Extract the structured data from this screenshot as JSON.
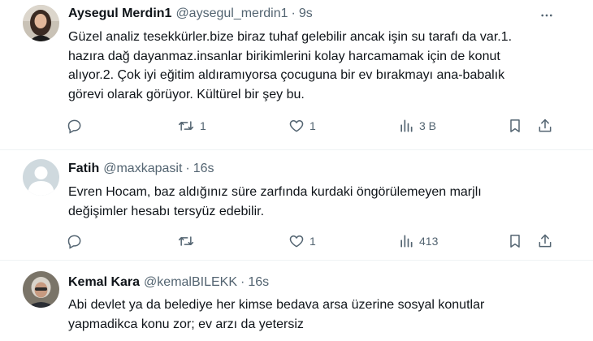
{
  "tweets": [
    {
      "name": "Aysegul Merdin1",
      "handle": "@aysegul_merdin1",
      "dot": "·",
      "time": "9s",
      "lines": [
        "Güzel analiz tesekkürler.bize biraz tuhaf gelebilir ancak işin su tarafı da var.1.",
        "hazıra dağ dayanmaz.insanlar birikimlerini kolay harcamamak için de konut",
        "alıyor.2. Çok iyi eğitim aldıramıyorsa çocuguna bir ev bırakmayı ana-babalık",
        "görevi olarak görüyor. Kültürel bir şey bu."
      ],
      "retweets": "1",
      "likes": "1",
      "views": "3 B"
    },
    {
      "name": "Fatih",
      "handle": "@maxkapasit",
      "dot": "·",
      "time": "16s",
      "lines": [
        "Evren Hocam, baz aldığınız süre zarfında kurdaki öngörülemeyen marjlı",
        "değişimler hesabı tersyüz edebilir."
      ],
      "retweets": "",
      "likes": "1",
      "views": "413"
    },
    {
      "name": "Kemal Kara",
      "handle": "@kemalBILEKK",
      "dot": "·",
      "time": "16s",
      "lines": [
        "Abi devlet ya da belediye her kimse bedava arsa üzerine sosyal konutlar",
        "yapmadikca konu zor; ev arzı da yetersiz"
      ]
    }
  ],
  "icons": {
    "more": "more-icon",
    "reply": "reply-icon",
    "retweet": "retweet-icon",
    "like": "like-icon",
    "views": "views-icon",
    "bookmark": "bookmark-icon",
    "share": "share-icon"
  },
  "colors": {
    "text": "#0f1419",
    "secondary": "#536471",
    "divider": "#eff3f4"
  }
}
